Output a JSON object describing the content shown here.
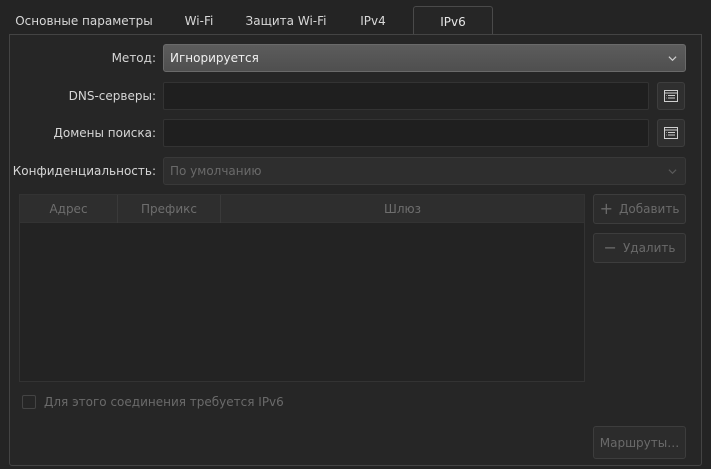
{
  "tabs": [
    {
      "label": "Основные параметры"
    },
    {
      "label": "Wi-Fi"
    },
    {
      "label": "Защита Wi-Fi"
    },
    {
      "label": "IPv4"
    },
    {
      "label": "IPv6"
    }
  ],
  "active_tab": "IPv6",
  "form": {
    "method_label": "Метод:",
    "method_value": "Игнорируется",
    "dns_label": "DNS-серверы:",
    "dns_value": "",
    "search_domains_label": "Домены поиска:",
    "search_domains_value": "",
    "privacy_label": "Конфиденциальность:",
    "privacy_value": "По умолчанию"
  },
  "address_table": {
    "columns": [
      "Адрес",
      "Префикс",
      "Шлюз"
    ],
    "rows": []
  },
  "buttons": {
    "add_label": "Добавить",
    "delete_label": "Удалить",
    "routes_label": "Маршруты…"
  },
  "require_ipv6_label": "Для этого соединения требуется IPv6",
  "require_ipv6_checked": false
}
